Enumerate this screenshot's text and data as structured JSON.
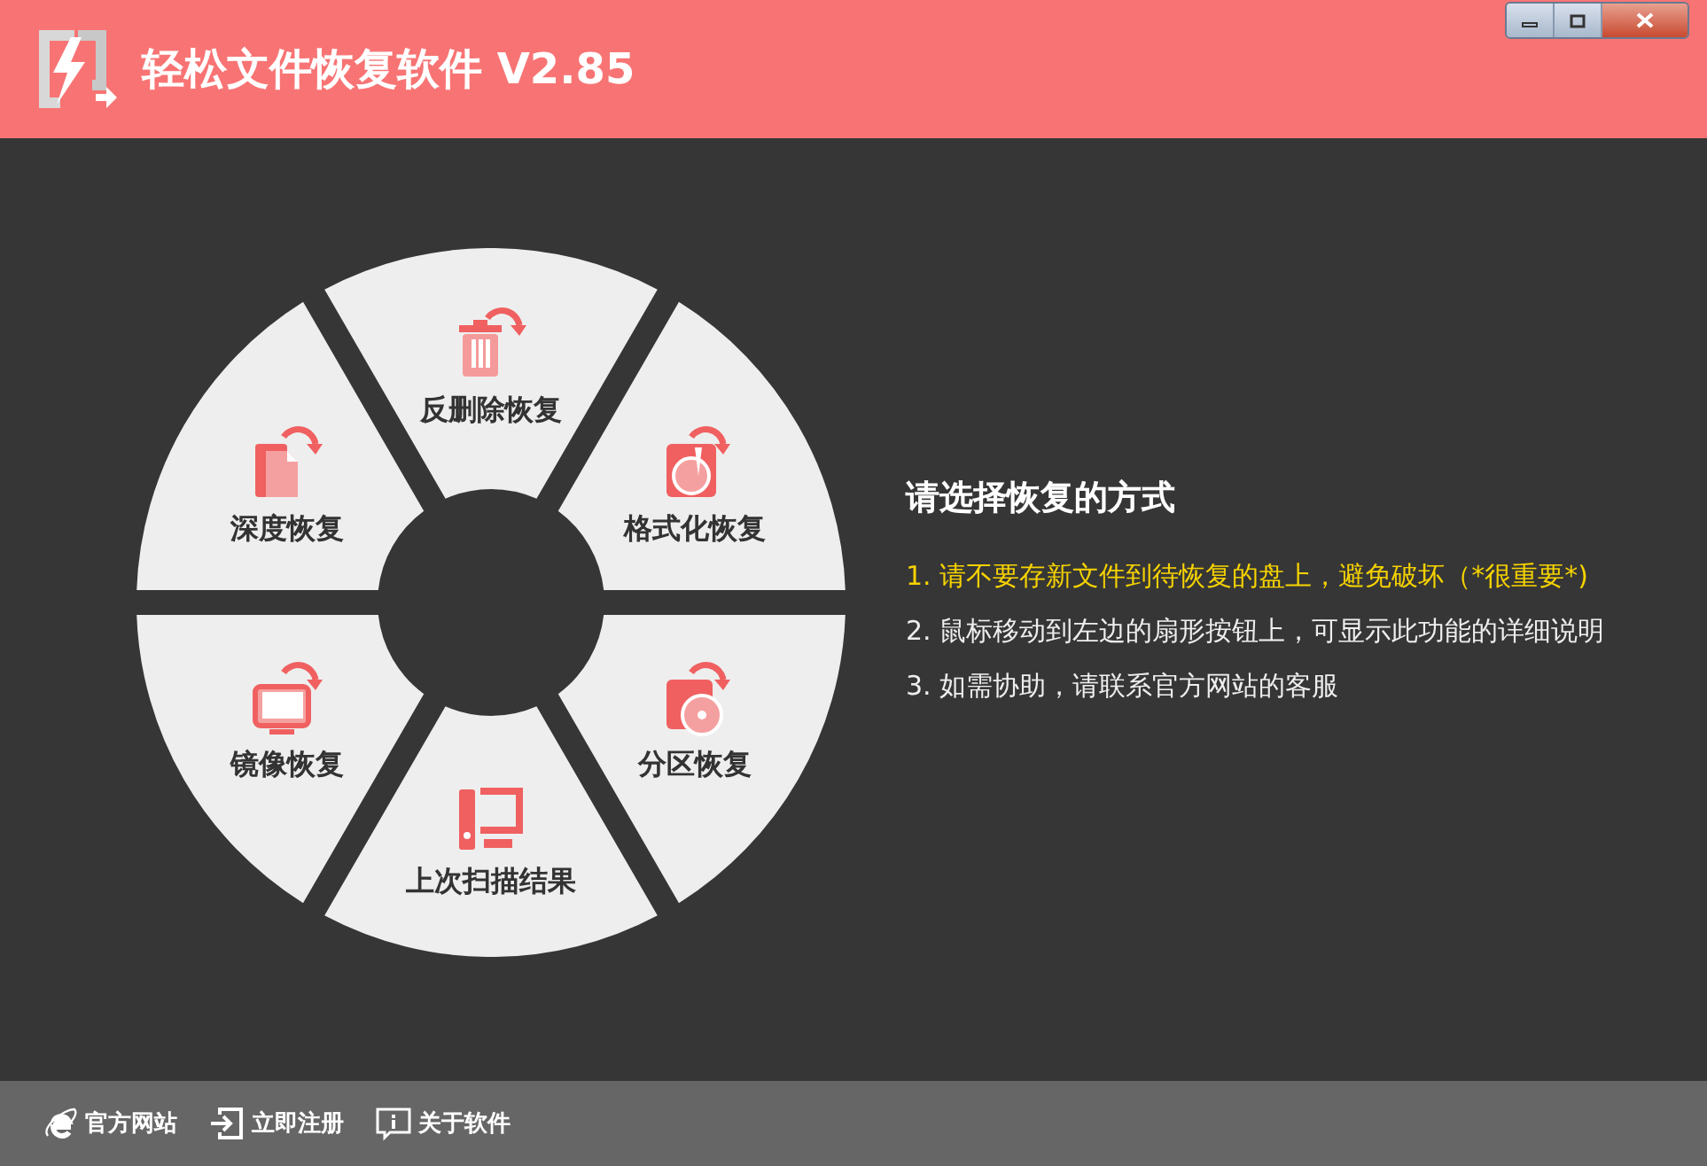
{
  "window": {
    "title": "轻松文件恢复软件 V2.85"
  },
  "modes": [
    {
      "label": "反删除恢复",
      "kind": "trash"
    },
    {
      "label": "格式化恢复",
      "kind": "format"
    },
    {
      "label": "分区恢复",
      "kind": "partition"
    },
    {
      "label": "上次扫描结果",
      "kind": "computer"
    },
    {
      "label": "镜像恢复",
      "kind": "monitor"
    },
    {
      "label": "深度恢复",
      "kind": "files"
    }
  ],
  "instructions": {
    "heading": "请选择恢复的方式",
    "lines": [
      {
        "text": "1. 请不要存新文件到待恢复的盘上，避免破坏（*很重要*)",
        "kind": "warning"
      },
      {
        "text": "2. 鼠标移动到左边的扇形按钮上，可显示此功能的详细说明",
        "kind": "normal"
      },
      {
        "text": "3. 如需协助，请联系官方网站的客服",
        "kind": "normal"
      }
    ]
  },
  "footer": [
    {
      "label": "官方网站",
      "kind": "web"
    },
    {
      "label": "立即注册",
      "kind": "register"
    },
    {
      "label": "关于软件",
      "kind": "about"
    }
  ]
}
